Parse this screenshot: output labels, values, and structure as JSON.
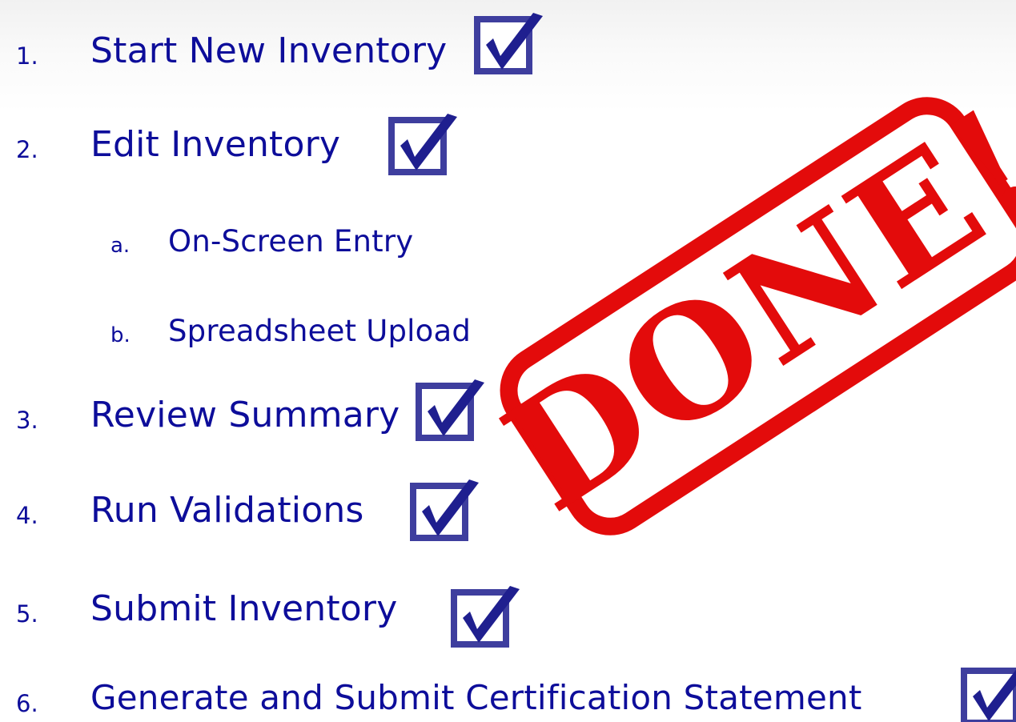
{
  "checklist": [
    {
      "number": "1.",
      "label": "Start New Inventory",
      "checked": true
    },
    {
      "number": "2.",
      "label": "Edit Inventory",
      "checked": true
    },
    {
      "number": "a.",
      "label": "On-Screen Entry",
      "checked": false
    },
    {
      "number": "b.",
      "label": "Spreadsheet Upload",
      "checked": false
    },
    {
      "number": "3.",
      "label": "Review Summary",
      "checked": true
    },
    {
      "number": "4.",
      "label": "Run Validations",
      "checked": true
    },
    {
      "number": "5.",
      "label": "Submit Inventory",
      "checked": true
    },
    {
      "number": "6.",
      "label": "Generate and Submit Certification Statement",
      "checked": true
    }
  ],
  "stamp": {
    "text": "DONE!",
    "color": "#e30b0b"
  },
  "colors": {
    "text": "#0d0d9a",
    "checkbox_border": "#3e3e9e",
    "checkmark": "#1f1f8f"
  },
  "icons": {
    "checkbox": "checked-checkbox-icon",
    "stamp": "done-stamp-icon"
  }
}
